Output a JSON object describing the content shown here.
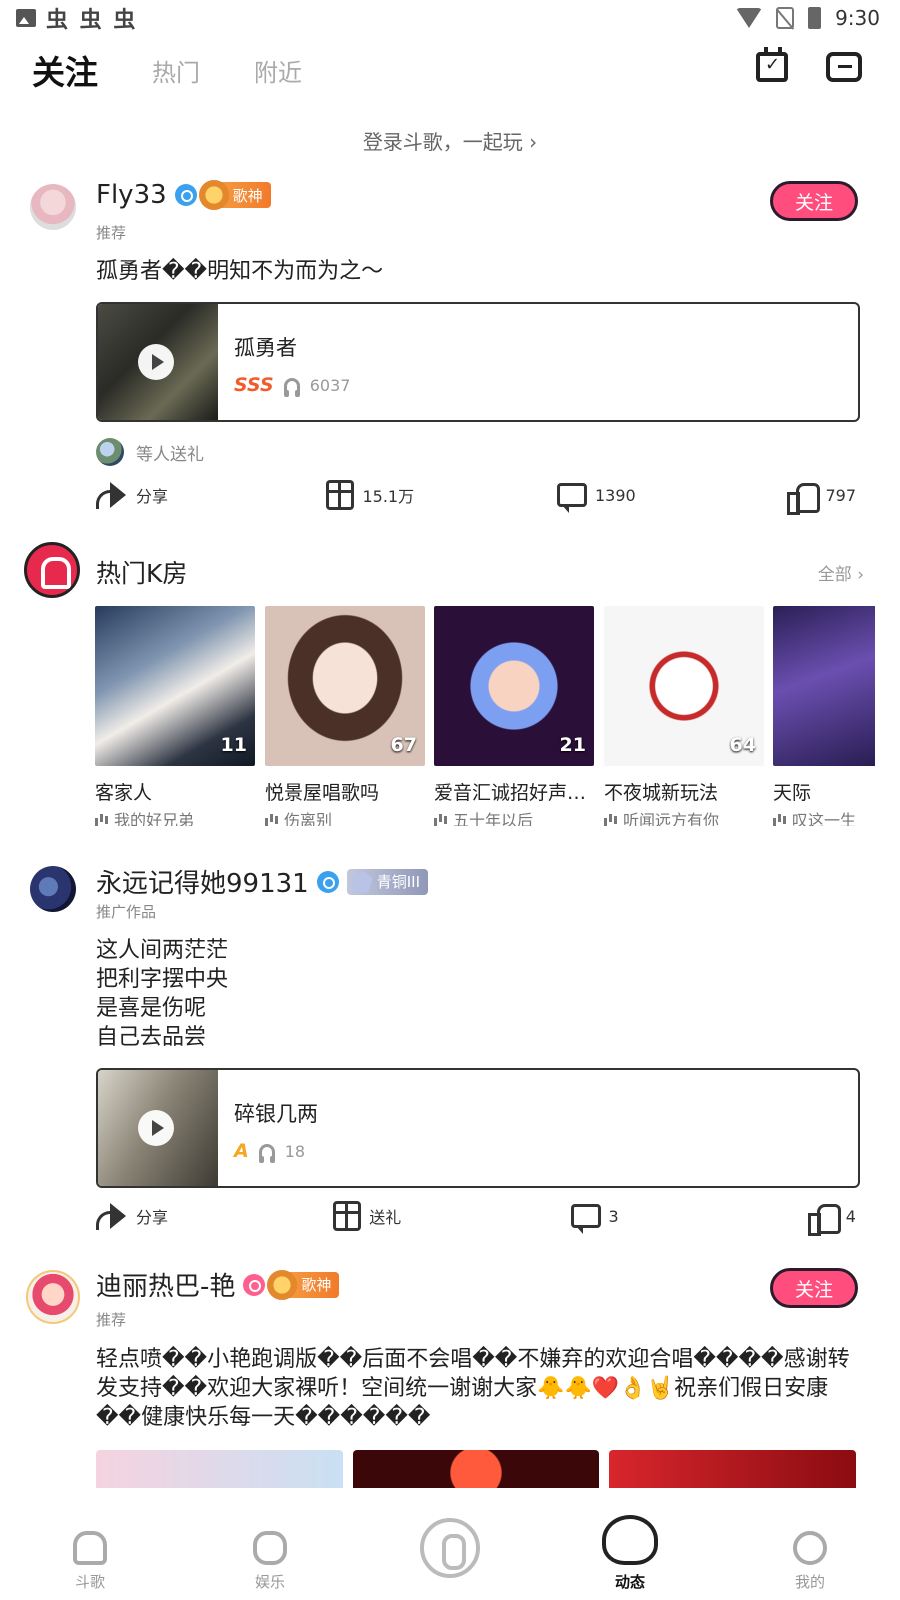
{
  "status_bar": {
    "time": "9:30",
    "app_icons": "虫 虫 虫"
  },
  "top_tabs": [
    {
      "label": "关注"
    },
    {
      "label": "热门"
    },
    {
      "label": "附近"
    }
  ],
  "top_icons": [
    "calendar-check-icon",
    "message-icon"
  ],
  "login_hint": "登录斗歌，一起玩 ›",
  "post1": {
    "user": "Fly33",
    "badge": "歌神",
    "sub_label": "推荐",
    "follow": "关注",
    "text": "孤勇者��明知不为而为之～",
    "song": {
      "title": "孤勇者",
      "grade": "SSS",
      "listens": "6037"
    },
    "gift_text": "等人送礼",
    "actions": {
      "share": "分享",
      "gift": "15.1万",
      "comment": "1390",
      "like": "797"
    }
  },
  "ktv": {
    "title": "热门K房",
    "all": "全部 ›",
    "rooms": [
      {
        "name": "客家人",
        "song": "我的好兄弟",
        "count": "11"
      },
      {
        "name": "悦景屋唱歌吗",
        "song": "伤离别",
        "count": "67"
      },
      {
        "name": "爱音汇诚招好声…",
        "song": "五十年以后",
        "count": "21"
      },
      {
        "name": "不夜城新玩法",
        "song": "听闻远方有你",
        "count": "64"
      },
      {
        "name": "天际",
        "song": "叹这一生",
        "count": ""
      }
    ]
  },
  "post2": {
    "user": "永远记得她99131",
    "badge": "青铜III",
    "sub_label": "推广作品",
    "text": "这人间两茫茫\n把利字摆中央\n是喜是伤呢\n自己去品尝",
    "song": {
      "title": "碎银几两",
      "grade": "A",
      "listens": "18"
    },
    "actions": {
      "share": "分享",
      "gift": "送礼",
      "comment": "3",
      "like": "4"
    }
  },
  "post3": {
    "user": "迪丽热巴-艳",
    "badge": "歌神",
    "sub_label": "推荐",
    "follow": "关注",
    "text": "轻点喷��小艳跑调版��后面不会唱��不嫌弃的欢迎合唱����感谢转发支持��欢迎大家裸听！空间统一谢谢大家🐥🐥❤️👌🤘祝亲们假日安康��健康快乐每一天������"
  },
  "bottom_nav": [
    {
      "label": "斗歌"
    },
    {
      "label": "娱乐"
    },
    {
      "label": ""
    },
    {
      "label": "动态"
    },
    {
      "label": "我的"
    }
  ]
}
